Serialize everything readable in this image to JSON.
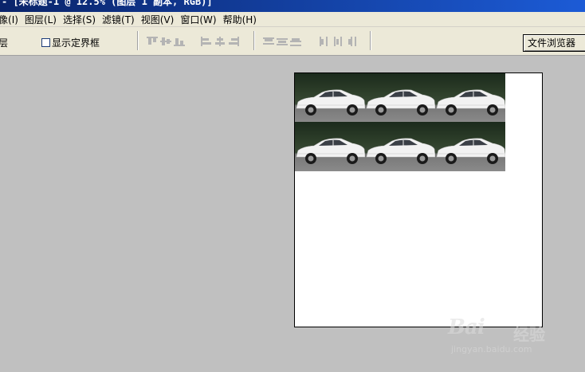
{
  "title_bar": {
    "title": "- [未标题-1 @ 12.5% (图层 1 副本, RGB)]"
  },
  "menu": {
    "items": [
      {
        "label": "像",
        "accel": "(I)"
      },
      {
        "label": "图层",
        "accel": "(L)"
      },
      {
        "label": "选择",
        "accel": "(S)"
      },
      {
        "label": "滤镜",
        "accel": "(T)"
      },
      {
        "label": "视图",
        "accel": "(V)"
      },
      {
        "label": "窗口",
        "accel": "(W)"
      },
      {
        "label": "帮助",
        "accel": "(H)"
      }
    ]
  },
  "options": {
    "layer_label": "层",
    "show_bounding_box": "显示定界框",
    "show_bounding_box_checked": false,
    "file_browser": "文件浏览器"
  },
  "document": {
    "tiles_rows": 2,
    "tiles_cols": 3,
    "tile_icon": "white-sedan-photo"
  },
  "watermark": {
    "brand": "Bai",
    "brand_suffix": "经验",
    "url": "jingyan.baidu.com"
  }
}
